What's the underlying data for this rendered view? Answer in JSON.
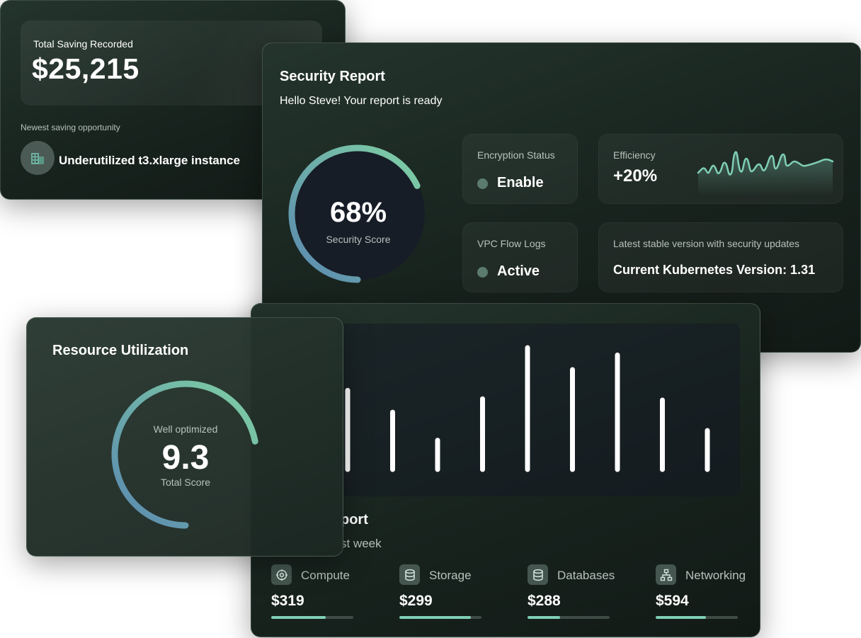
{
  "savings": {
    "hero_label": "Total Saving Recorded",
    "hero_value": "$25,215",
    "opportunity_label": "Newest saving opportunity",
    "opportunity_icon": "building-icon",
    "opportunity_text": "Underutilized t3.xlarge instance"
  },
  "security": {
    "title": "Security Report",
    "subtitle": "Hello Steve! Your report is ready",
    "score_value": "68%",
    "score_fraction": 0.68,
    "score_label": "Security Score",
    "encryption": {
      "label": "Encryption Status",
      "value": "Enable"
    },
    "vpc": {
      "label": "VPC Flow Logs",
      "value": "Active"
    },
    "efficiency": {
      "label": "Efficiency",
      "value": "+20%"
    },
    "kubernetes": {
      "label": "Latest stable version with security updates",
      "value": "Current Kubernetes Version: 1.31"
    }
  },
  "cost": {
    "title": "port",
    "subtitle": "st week",
    "bar_levels": [
      0.65,
      0.47,
      0.24,
      0.58,
      1.0,
      0.82,
      0.94,
      0.57,
      0.32
    ],
    "categories": [
      {
        "label": "Compute",
        "value": "$319",
        "icon": "compute-icon",
        "fill": 0.66
      },
      {
        "label": "Storage",
        "value": "$299",
        "icon": "storage-icon",
        "fill": 0.87
      },
      {
        "label": "Databases",
        "value": "$288",
        "icon": "database-icon",
        "fill": 0.4
      },
      {
        "label": "Networking",
        "value": "$594",
        "icon": "network-icon",
        "fill": 0.61
      }
    ]
  },
  "resource": {
    "title": "Resource Utilization",
    "top_label": "Well optimized",
    "value": "9.3",
    "bottom_label": "Total Score",
    "score_fraction": 0.72
  },
  "colors": {
    "accent": "#7fcfb6",
    "gauge_start": "#5a88b0",
    "gauge_end": "#7fd0a4"
  }
}
